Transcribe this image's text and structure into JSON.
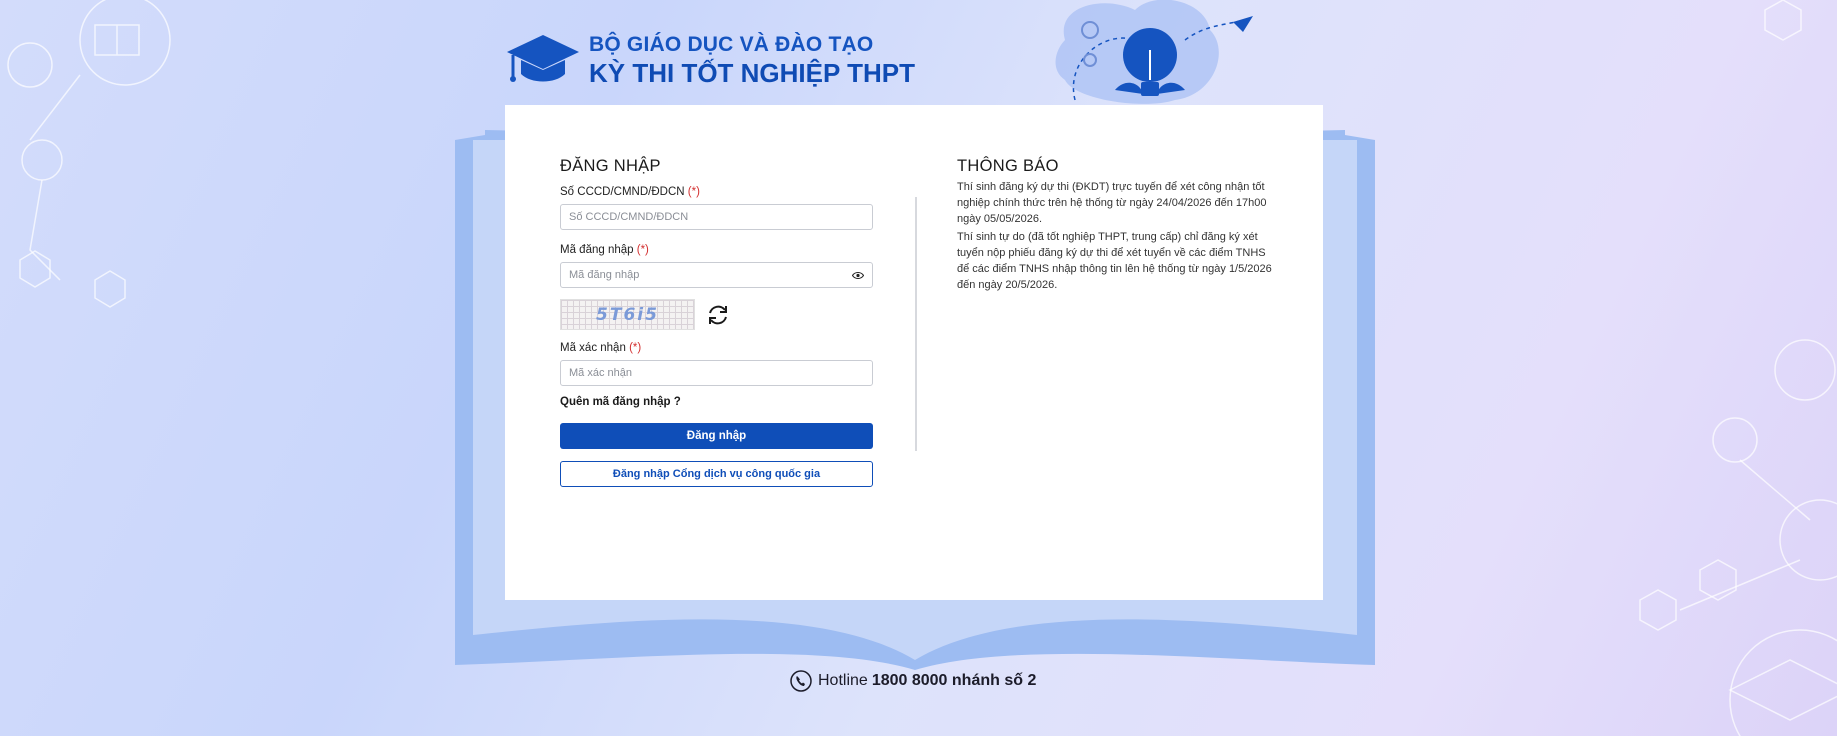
{
  "header": {
    "ministry": "BỘ GIÁO DỤC VÀ ĐÀO TẠO",
    "exam_title": "KỲ THI TỐT NGHIỆP THPT"
  },
  "login": {
    "title": "ĐĂNG NHẬP",
    "id_label": "Số CCCD/CMND/ĐDCN",
    "id_placeholder": "Số CCCD/CMND/ĐDCN",
    "code_label": "Mã đăng nhập",
    "code_placeholder": "Mã đăng nhập",
    "captcha_text": "5T6i5",
    "verify_label": "Mã xác nhận",
    "verify_placeholder": "Mã xác nhận",
    "required_mark": "(*)",
    "forgot": "Quên mã đăng nhập ?",
    "login_button": "Đăng nhập",
    "national_portal_button": "Đăng nhập Cổng dịch vụ công quốc gia"
  },
  "notice": {
    "title": "THÔNG BÁO",
    "paragraphs": [
      "Thí sinh đăng ký dự thi (ĐKDT) trực tuyến để xét công nhận tốt nghiệp chính thức trên hệ thống từ ngày 24/04/2026 đến 17h00 ngày 05/05/2026.",
      "Thí sinh tự do (đã tốt nghiệp THPT, trung cấp) chỉ đăng ký xét tuyển nộp phiếu đăng ký dự thi để xét tuyển về các điểm TNHS để các điểm TNHS nhập thông tin lên hệ thống từ ngày 1/5/2026 đến ngày 20/5/2026."
    ]
  },
  "footer": {
    "hotline_label": "Hotline",
    "hotline_number": "1800 8000 nhánh số 2"
  },
  "icons": [
    "graduation-cap-icon",
    "lightbulb-icon",
    "eye-icon",
    "refresh-icon",
    "phone-icon"
  ],
  "colors": {
    "brand": "#0f4eb8",
    "required": "#d32f2f",
    "book": "#9dbcf2"
  }
}
